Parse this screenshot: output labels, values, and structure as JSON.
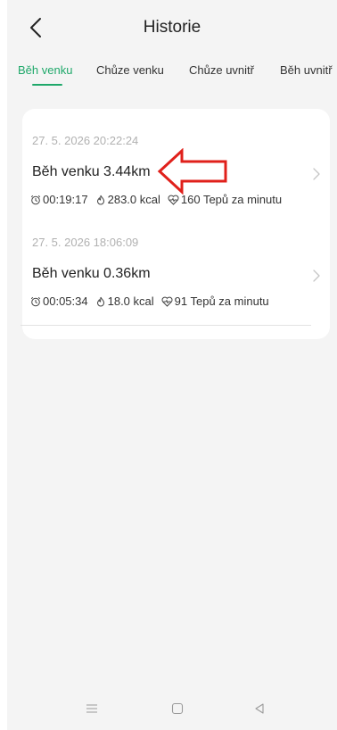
{
  "header": {
    "title": "Historie"
  },
  "tabs": [
    {
      "label": "Běh venku",
      "active": true
    },
    {
      "label": "Chůze venku",
      "active": false
    },
    {
      "label": "Chůze uvnitř",
      "active": false
    },
    {
      "label": "Běh uvnitř",
      "active": false
    }
  ],
  "records": [
    {
      "date": "27. 5. 2026 20:22:24",
      "name": "Běh venku 3.44km",
      "duration": "00:19:17",
      "calories": "283.0 kcal",
      "heart_rate": "160 Tepů za minutu"
    },
    {
      "date": "27. 5. 2026 18:06:09",
      "name": "Běh venku 0.36km",
      "duration": "00:05:34",
      "calories": "18.0 kcal",
      "heart_rate": "91 Tepů za minutu"
    }
  ],
  "colors": {
    "accent": "#1fa86a",
    "annotation_arrow": "#e0201b",
    "background": "#f4f4f4",
    "card": "#ffffff"
  },
  "icons": {
    "back": "chevron-left-icon",
    "duration": "alarm-clock-icon",
    "calories": "flame-icon",
    "heart_rate": "heart-pulse-icon",
    "row_chevron": "chevron-right-icon",
    "nav": [
      "menu-icon",
      "home-square-icon",
      "back-triangle-icon"
    ]
  }
}
